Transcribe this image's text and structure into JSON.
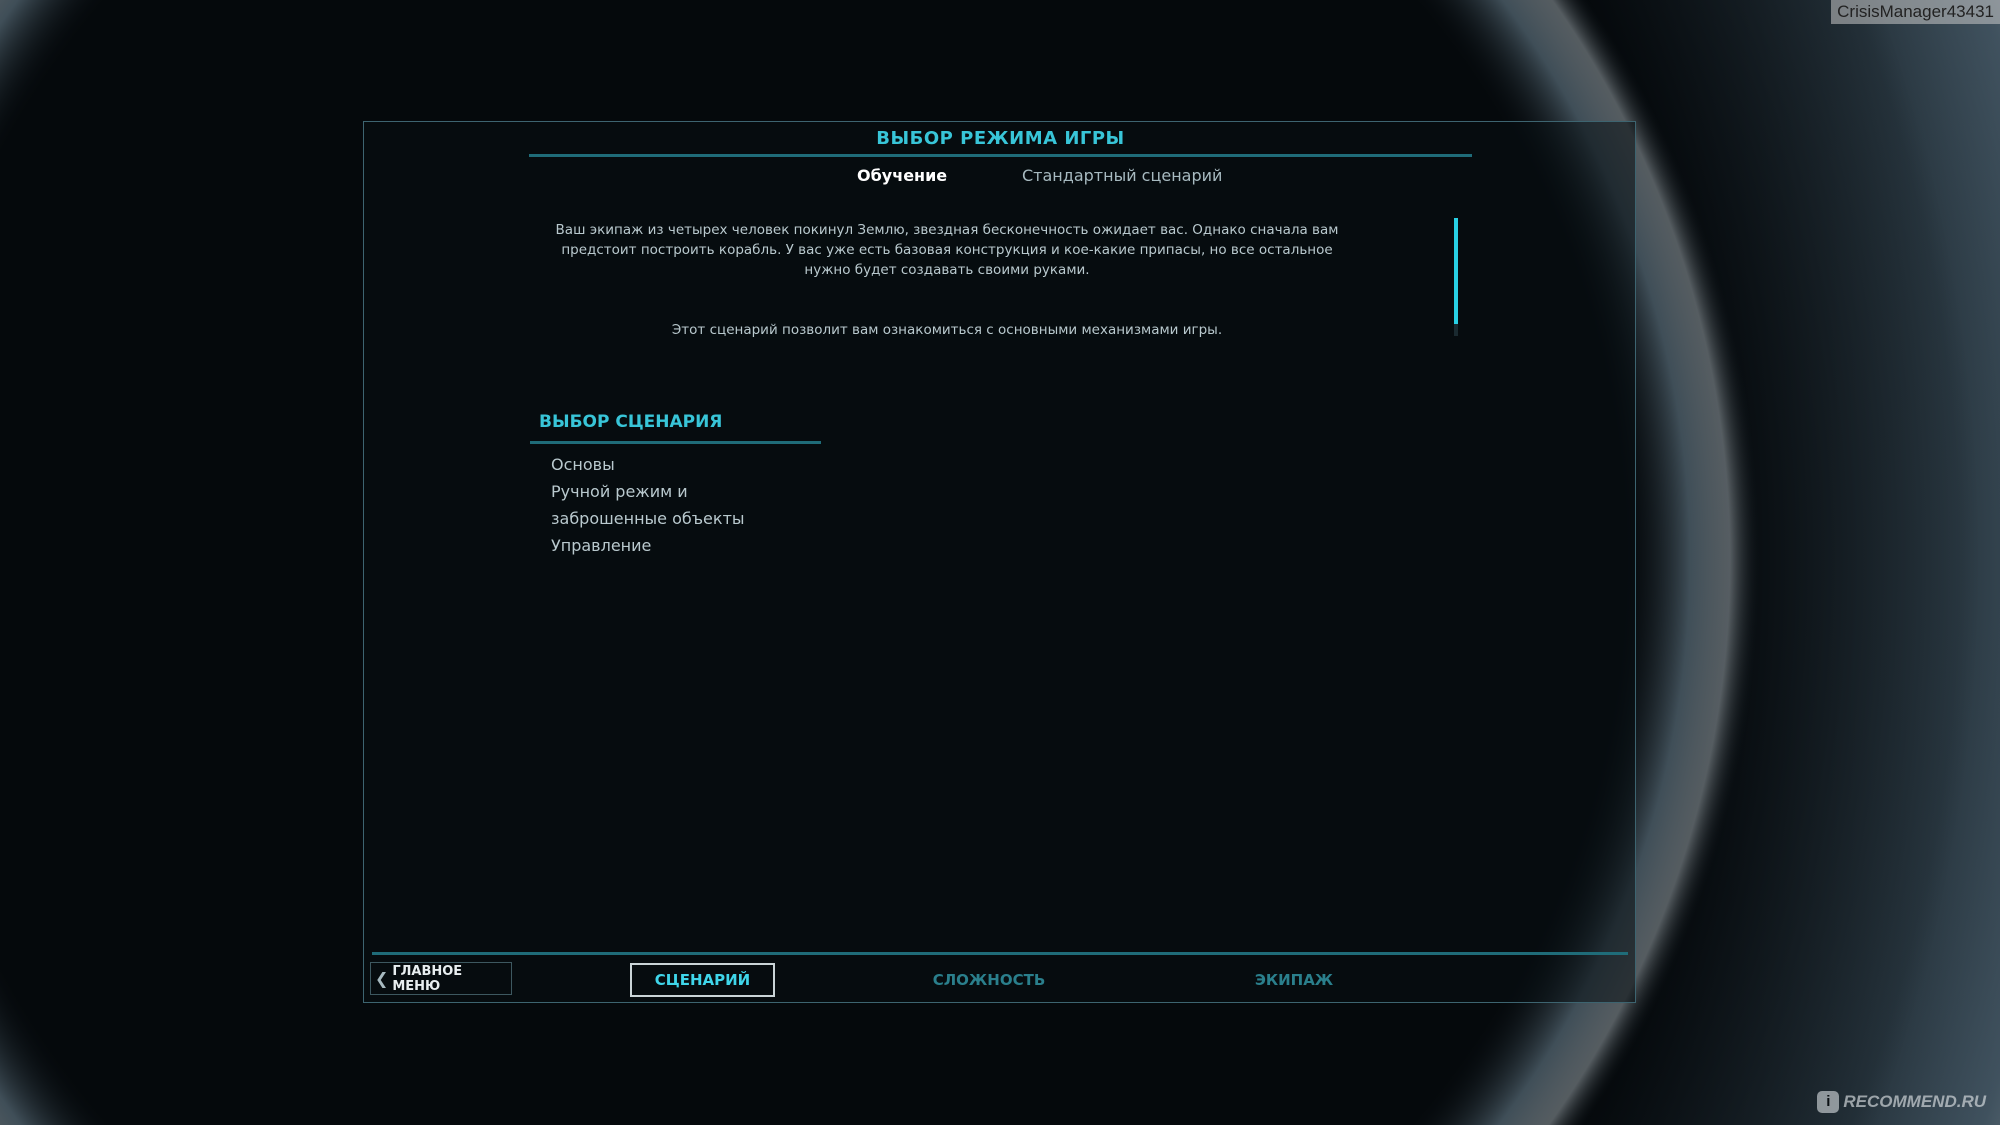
{
  "window": {
    "title": "ВЫБОР РЕЖИМА ИГРЫ"
  },
  "tabs": [
    {
      "label": "Обучение",
      "active": true
    },
    {
      "label": "Стандартный сценарий",
      "active": false
    }
  ],
  "description": {
    "paragraph1": "Ваш экипаж из четырех человек покинул Землю, звездная бесконечность ожидает вас. Однако сначала вам предстоит построить корабль. У вас уже есть базовая конструкция и кое-какие припасы, но все остальное нужно будет создавать своими руками.",
    "paragraph2": "Этот сценарий позволит вам ознакомиться с основными механизмами игры."
  },
  "scenario": {
    "heading": "ВЫБОР СЦЕНАРИЯ",
    "items": [
      "Основы",
      "Ручной режим и заброшенные объекты",
      "Управление"
    ]
  },
  "footer": {
    "main_menu_label": "ГЛАВНОЕ МЕНЮ",
    "steps": [
      {
        "label": "СЦЕНАРИЙ",
        "active": true
      },
      {
        "label": "СЛОЖНОСТЬ",
        "active": false
      },
      {
        "label": "ЭКИПАЖ",
        "active": false
      }
    ]
  },
  "overlay": {
    "username": "CrisisManager43431",
    "watermark": "RECOMMEND.RU"
  },
  "colors": {
    "accent": "#38c5d8",
    "accent_dark": "#1f6c79",
    "text": "#b9c9ce",
    "active_text": "#ffffff"
  }
}
